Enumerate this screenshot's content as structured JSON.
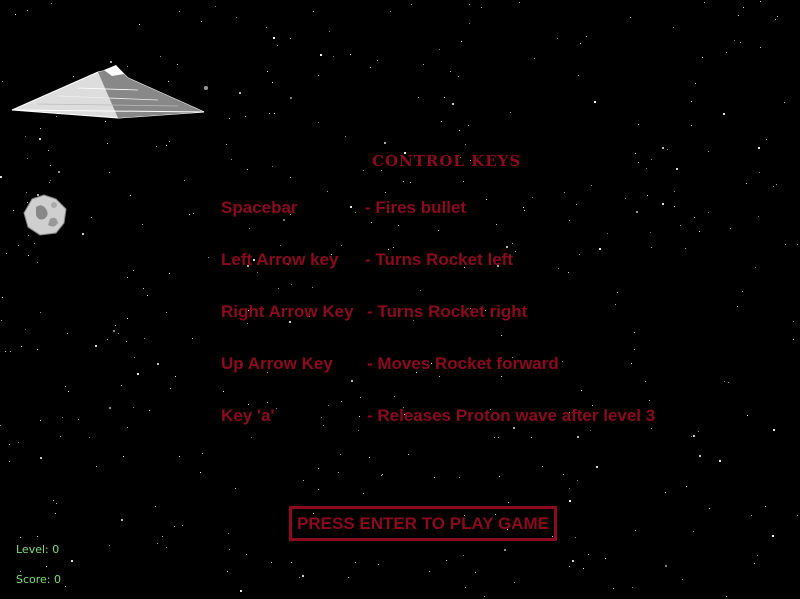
{
  "title": "CONTROL KEYS",
  "controls": [
    {
      "key": "Spacebar",
      "action": "- Fires bullet"
    },
    {
      "key": "Left Arrow key",
      "action": "- Turns Rocket left"
    },
    {
      "key": "Right Arrow Key",
      "action": "- Turns Rocket right"
    },
    {
      "key": "Up Arrow Key",
      "action": "- Moves Rocket forward"
    },
    {
      "key": "Key 'a'",
      "action": "- Releases Proton wave after level 3"
    }
  ],
  "start_prompt": "PRESS ENTER TO PLAY GAME",
  "hud": {
    "level": "Level: 0",
    "score": "Score: 0"
  },
  "colors": {
    "text_red": "#8b0a1e",
    "hud_green": "#7fdc7f",
    "background": "#000000"
  },
  "sprites": [
    "star-destroyer-ship",
    "asteroid"
  ]
}
